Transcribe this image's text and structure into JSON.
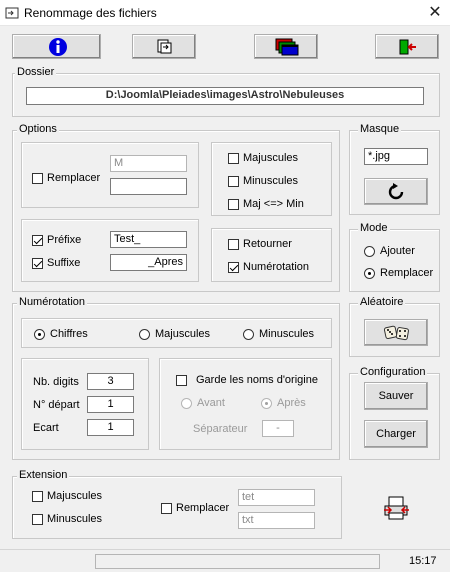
{
  "window": {
    "title": "Renommage des fichiers"
  },
  "dossier": {
    "legend": "Dossier",
    "path": "D:\\Joomla\\Pleiades\\images\\Astro\\Nebuleuses"
  },
  "options": {
    "legend": "Options",
    "remplacer_label": "Remplacer",
    "remplacer_from": "M",
    "remplacer_to": "",
    "majuscules": "Majuscules",
    "minuscules": "Minuscules",
    "maj_min": "Maj <=> Min",
    "prefixe_label": "Préfixe",
    "prefixe_value": "Test_",
    "suffixe_label": "Suffixe",
    "suffixe_value": "_Apres",
    "retourner": "Retourner",
    "numerotation": "Numérotation"
  },
  "masque": {
    "legend": "Masque",
    "value": "*.jpg"
  },
  "mode": {
    "legend": "Mode",
    "ajouter": "Ajouter",
    "remplacer": "Remplacer"
  },
  "numerotation": {
    "legend": "Numérotation",
    "chiffres": "Chiffres",
    "majuscules": "Majuscules",
    "minuscules": "Minuscules",
    "nb_digits_label": "Nb. digits",
    "nb_digits": "3",
    "depart_label": "N° départ",
    "depart": "1",
    "ecart_label": "Ecart",
    "ecart": "1",
    "garde_noms": "Garde les noms d'origine",
    "avant": "Avant",
    "apres": "Après",
    "separateur_label": "Séparateur",
    "separateur": "-"
  },
  "aleatoire": {
    "legend": "Aléatoire"
  },
  "configuration": {
    "legend": "Configuration",
    "sauver": "Sauver",
    "charger": "Charger"
  },
  "extension": {
    "legend": "Extension",
    "majuscules": "Majuscules",
    "minuscules": "Minuscules",
    "remplacer": "Remplacer",
    "from": "tet",
    "to": "txt"
  },
  "status": {
    "time": "15:17"
  }
}
